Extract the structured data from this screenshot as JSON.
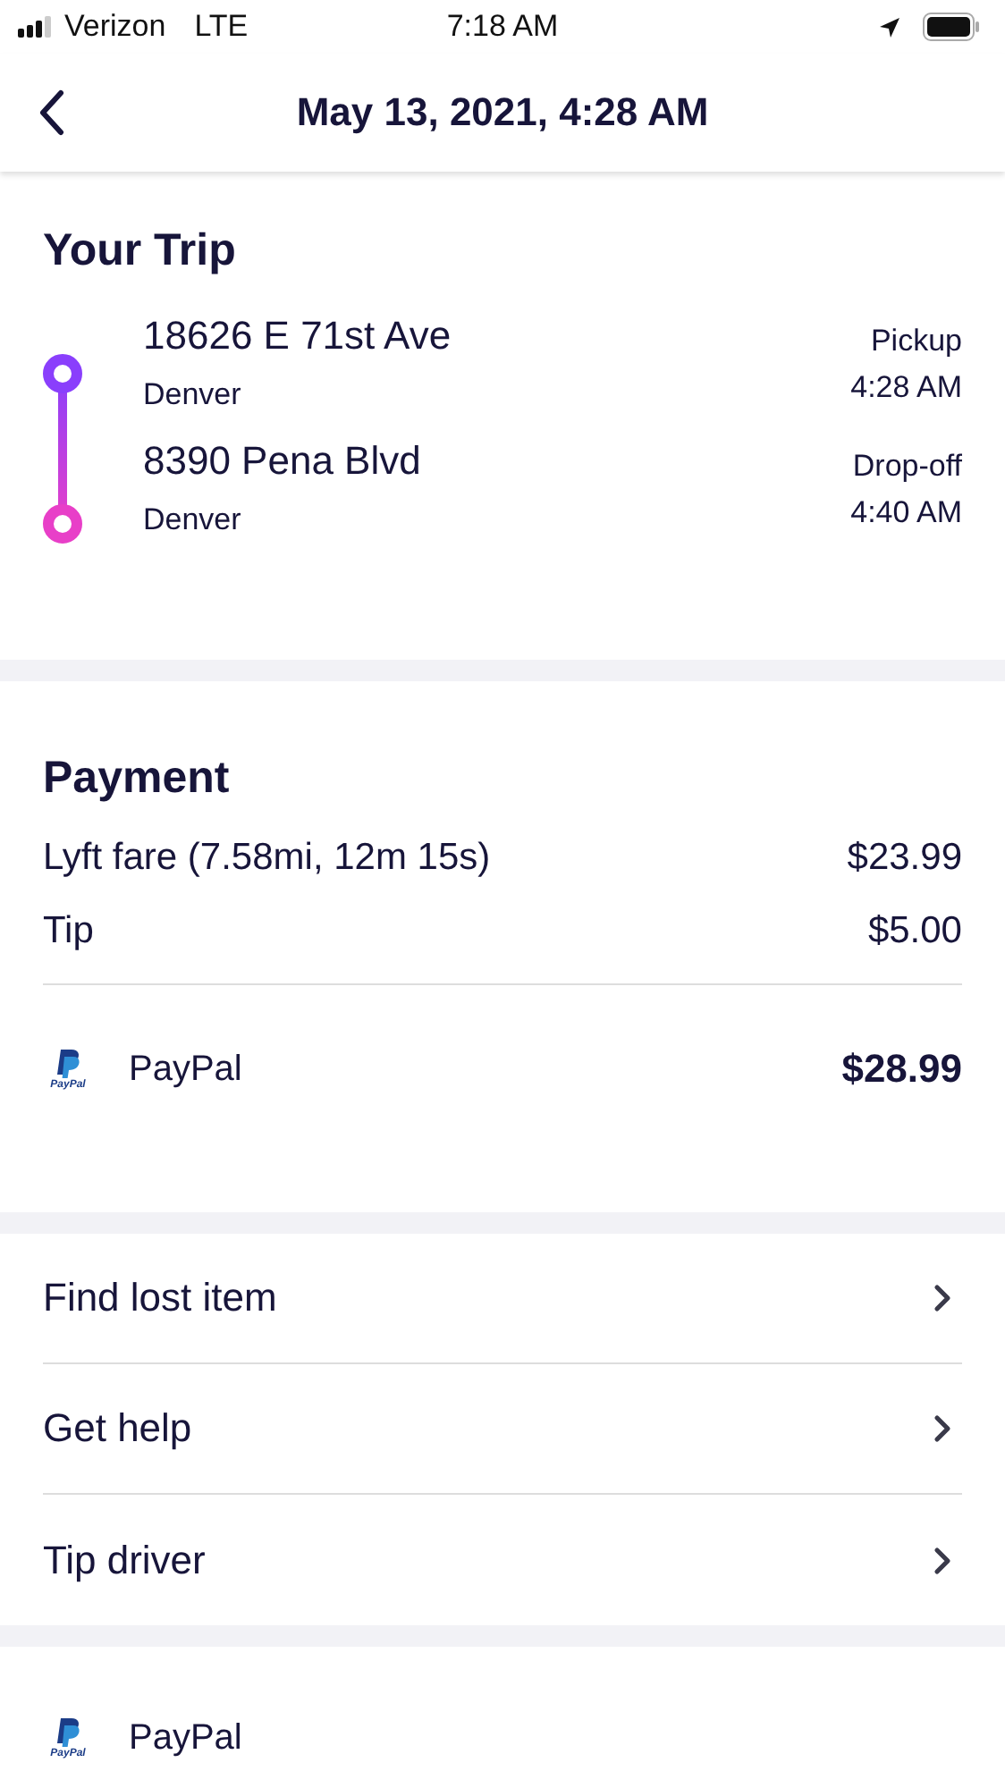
{
  "status_bar": {
    "carrier": "Verizon",
    "network": "LTE",
    "time": "7:18 AM"
  },
  "header": {
    "title": "May 13, 2021, 4:28 AM"
  },
  "trip": {
    "heading": "Your Trip",
    "stops": [
      {
        "address": "18626 E 71st Ave",
        "city": "Denver",
        "label": "Pickup",
        "time": "4:28 AM",
        "color": "#8a3ffc"
      },
      {
        "address": "8390 Pena Blvd",
        "city": "Denver",
        "label": "Drop-off",
        "time": "4:40 AM",
        "color": "#e83fc8"
      }
    ]
  },
  "payment": {
    "heading": "Payment",
    "lines": [
      {
        "label": "Lyft fare (7.58mi, 12m 15s)",
        "amount": "$23.99"
      },
      {
        "label": "Tip",
        "amount": "$5.00"
      }
    ],
    "method": {
      "logo_text": "PayPal",
      "name": "PayPal",
      "total": "$28.99"
    }
  },
  "actions": [
    "Find lost item",
    "Get help",
    "Tip driver"
  ],
  "footer_method": {
    "logo_text": "PayPal",
    "name": "PayPal"
  }
}
